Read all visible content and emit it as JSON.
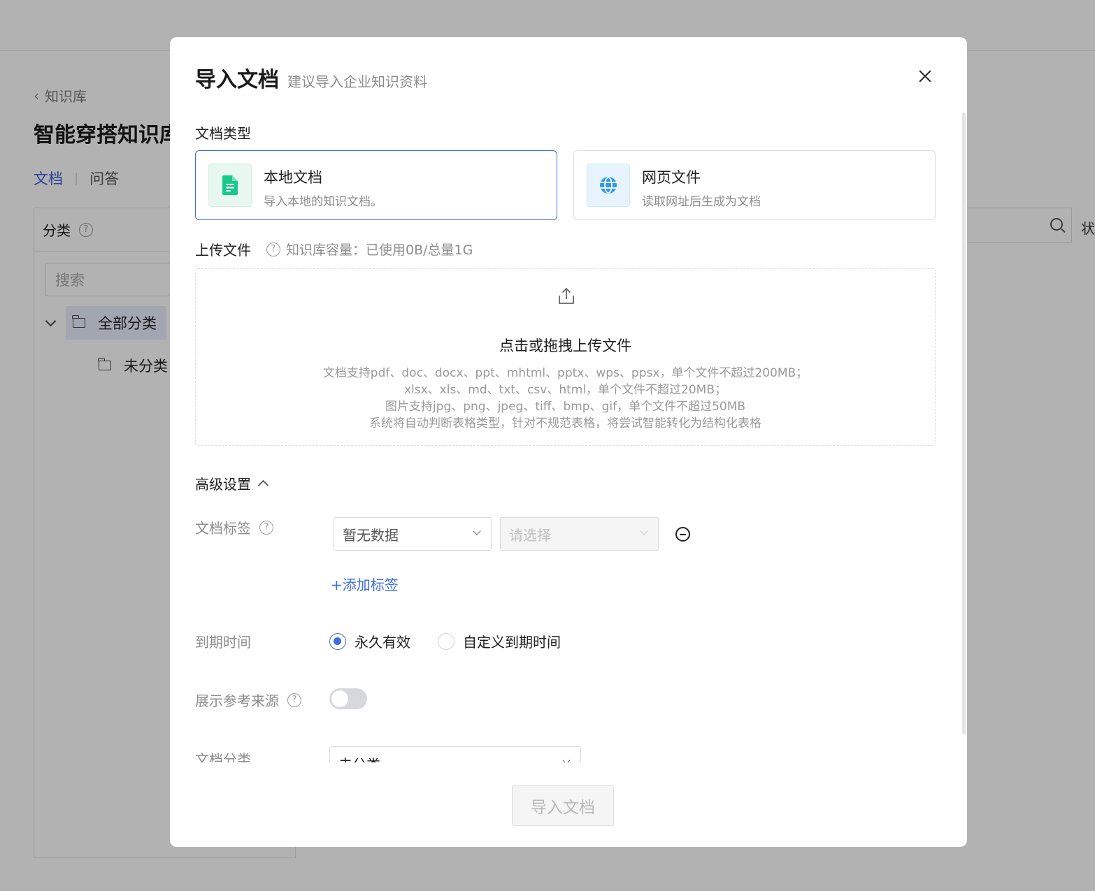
{
  "background": {
    "back_label": "知识库",
    "title": "智能穿搭知识库",
    "tabs": [
      {
        "label": "文档"
      },
      {
        "label": "问答"
      }
    ],
    "panel": {
      "title": "分类",
      "search_placeholder": "搜索",
      "tree": [
        {
          "label": "全部分类"
        },
        {
          "label": "未分类"
        }
      ]
    },
    "status_label": "状"
  },
  "modal": {
    "title": "导入文档",
    "subtitle": "建议导入企业知识资料",
    "doc_type_label": "文档类型",
    "doc_types": [
      {
        "title": "本地文档",
        "desc": "导入本地的知识文档。",
        "selected": true,
        "icon": "document-icon",
        "color": "#18c98b"
      },
      {
        "title": "网页文件",
        "desc": "读取网址后生成为文档",
        "selected": false,
        "icon": "globe-icon",
        "color": "#2f9ae8"
      }
    ],
    "upload": {
      "label": "上传文件",
      "capacity_hint": "知识库容量：已使用0B/总量1G",
      "main_text": "点击或拖拽上传文件",
      "desc_lines": [
        "文档支持pdf、doc、docx、ppt、mhtml、pptx、wps、ppsx，单个文件不超过200MB；",
        "xlsx、xls、md、txt、csv、html，单个文件不超过20MB；",
        "图片支持jpg、png、jpeg、tiff、bmp、gif，单个文件不超过50MB",
        "系统将自动判断表格类型，针对不规范表格，将尝试智能转化为结构化表格"
      ]
    },
    "advanced": {
      "label": "高级设置",
      "tags": {
        "label": "文档标签",
        "select1_value": "暂无数据",
        "select2_placeholder": "请选择",
        "add_label": "+添加标签"
      },
      "expiry": {
        "label": "到期时间",
        "options": [
          {
            "label": "永久有效",
            "checked": true
          },
          {
            "label": "自定义到期时间",
            "checked": false
          }
        ]
      },
      "show_source": {
        "label": "展示参考来源",
        "enabled": false
      },
      "category": {
        "label": "文档分类",
        "value": "未分类"
      }
    },
    "submit_label": "导入文档"
  },
  "colors": {
    "accent": "#3b6de0",
    "overlay": "rgba(0,0,0,0.3)"
  }
}
